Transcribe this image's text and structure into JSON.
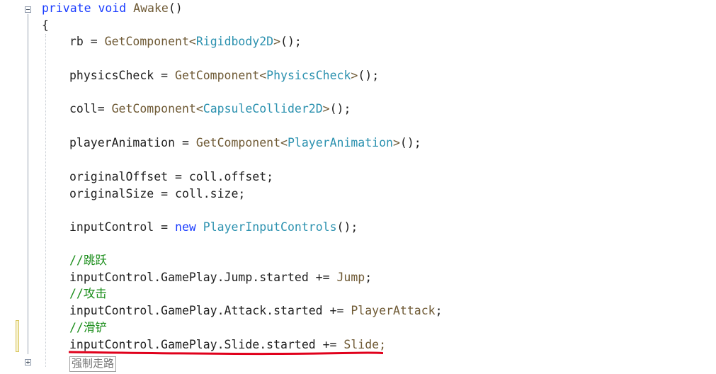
{
  "editor": {
    "lines": {
      "signature": {
        "kw1": "private",
        "kw2": "void",
        "name": "Awake",
        "parens": "()"
      },
      "open_brace": "{",
      "rb": {
        "lhs": "rb = ",
        "fn": "GetComponent",
        "lt": "<",
        "type": "Rigidbody2D",
        "gt": ">",
        "tail": "();"
      },
      "physics": {
        "lhs": "physicsCheck = ",
        "fn": "GetComponent",
        "lt": "<",
        "type": "PhysicsCheck",
        "gt": ">",
        "tail": "();"
      },
      "coll": {
        "lhs": "coll= ",
        "fn": "GetComponent",
        "lt": "<",
        "type": "CapsuleCollider2D",
        "gt": ">",
        "tail": "();"
      },
      "anim": {
        "lhs": "playerAnimation = ",
        "fn": "GetComponent",
        "lt": "<",
        "type": "PlayerAnimation",
        "gt": ">",
        "tail": "();"
      },
      "offset": "originalOffset = coll.offset;",
      "size": "originalSize = coll.size;",
      "input": {
        "lhs": "inputControl = ",
        "kw": "new",
        "type": "PlayerInputControls",
        "tail": "();"
      },
      "comment_jump": "//跳跃",
      "jump": {
        "lhs": "inputControl.GamePlay.Jump.started += ",
        "handler": "Jump",
        "tail": ";"
      },
      "comment_attack": "//攻击",
      "attack": {
        "lhs": "inputControl.GamePlay.Attack.started += ",
        "handler": "PlayerAttack",
        "tail": ";"
      },
      "comment_slide": "//滑铲",
      "slide": {
        "lhs": "inputControl.GamePlay.Slide.started += ",
        "handler": "Slide",
        "tail": ";"
      },
      "collapsed_region": "强制走路"
    }
  },
  "colors": {
    "keyword": "#1a3cff",
    "type": "#2b91af",
    "method": "#6f5a35",
    "comment": "#1a8d1a",
    "annotation": "#e0001b"
  },
  "icons": {
    "fold_open": "minus-box-icon",
    "fold_closed": "plus-box-icon"
  }
}
